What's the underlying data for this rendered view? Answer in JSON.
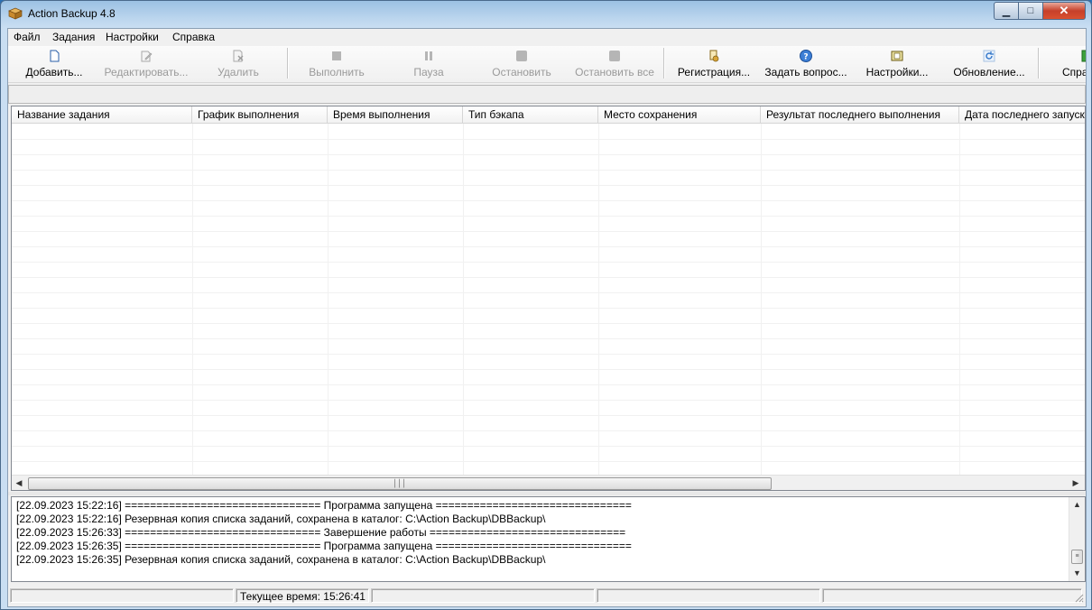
{
  "window": {
    "title": "Action Backup 4.8"
  },
  "menu": [
    "Файл",
    "Задания",
    "Настройки",
    "Справка"
  ],
  "toolbar": {
    "add": "Добавить...",
    "edit": "Редактировать...",
    "delete": "Удалить",
    "run": "Выполнить",
    "pause": "Пауза",
    "stop": "Остановить",
    "stop_all": "Остановить все",
    "register": "Регистрация...",
    "ask": "Задать вопрос...",
    "settings": "Настройки...",
    "update": "Обновление...",
    "help": "Справка"
  },
  "table": {
    "columns": [
      "Название задания",
      "График выполнения",
      "Время выполнения",
      "Тип бэкапа",
      "Место сохранения",
      "Результат последнего выполнения",
      "Дата последнего запуска"
    ],
    "rows": []
  },
  "log": [
    "[22.09.2023 15:22:16] =============================== Программа запущена ===============================",
    "[22.09.2023 15:22:16] Резервная копия списка заданий, сохранена в каталог: C:\\Action Backup\\DBBackup\\",
    "[22.09.2023 15:26:33] =============================== Завершение работы ===============================",
    "[22.09.2023 15:26:35] =============================== Программа запущена ===============================",
    "[22.09.2023 15:26:35] Резервная копия списка заданий, сохранена в каталог: C:\\Action Backup\\DBBackup\\"
  ],
  "status": {
    "time_label": "Текущее время: 15:26:41"
  },
  "colors": {
    "accent": "#2b6fb3",
    "disabled_text": "#9a9a9a",
    "close_button": "#c6402a"
  }
}
